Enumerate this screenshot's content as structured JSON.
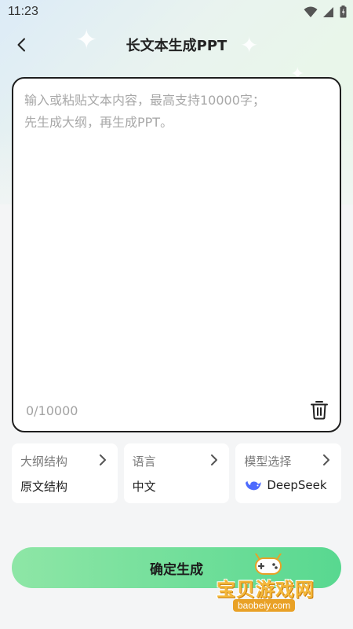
{
  "status_bar": {
    "time": "11:23",
    "icons": [
      "wifi-icon",
      "signal-icon",
      "battery-icon"
    ]
  },
  "header": {
    "title": "长文本生成PPT",
    "back_icon": "back-arrow-icon"
  },
  "editor": {
    "placeholder": "输入或粘贴文本内容，最高支持10000字；\n先生成大纲，再生成PPT。",
    "value": "",
    "char_count": "0/10000",
    "clear_icon": "trash-icon"
  },
  "options": [
    {
      "label": "大纲结构",
      "value": "原文结构"
    },
    {
      "label": "语言",
      "value": "中文"
    },
    {
      "label": "模型选择",
      "value": "DeepSeek",
      "icon": "deepseek-whale-icon"
    }
  ],
  "confirm_button": {
    "label": "确定生成"
  },
  "watermark": {
    "title": "宝贝游戏网",
    "url": "baobeiy.com",
    "icon": "gamepad-icon"
  },
  "colors": {
    "accent_start": "#8ee6a6",
    "accent_end": "#58d890",
    "card_border": "#1e1e1e",
    "deepseek_blue": "#4d6bfe",
    "watermark_orange": "#f4b83a"
  }
}
